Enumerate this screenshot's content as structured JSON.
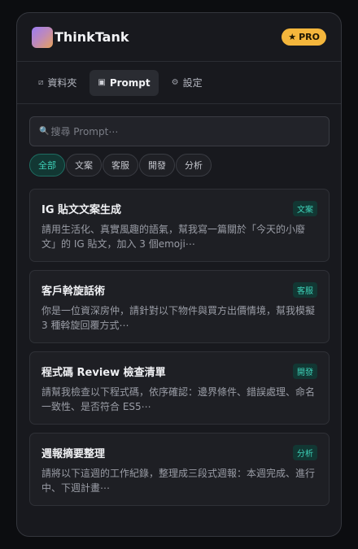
{
  "app": {
    "title": "ThinkTank",
    "badge": "PRO",
    "badge_icon": "★"
  },
  "colors": {
    "accent": "#3ed1b8",
    "badge_bg": "#f4b63c",
    "panel_bg": "#18191e"
  },
  "tabs": [
    {
      "label": "資料夾",
      "icon": "folder-icon",
      "glyph": "🗀",
      "active": false
    },
    {
      "label": "Prompt",
      "icon": "chat-icon",
      "glyph": "💬",
      "active": true
    },
    {
      "label": "設定",
      "icon": "gear-icon",
      "glyph": "⚙",
      "active": false
    }
  ],
  "search": {
    "placeholder": "搜尋 Prompt⋯",
    "icon": "search-icon"
  },
  "filters": [
    {
      "label": "全部",
      "active": true
    },
    {
      "label": "文案",
      "active": false
    },
    {
      "label": "客服",
      "active": false
    },
    {
      "label": "開發",
      "active": false
    },
    {
      "label": "分析",
      "active": false
    }
  ],
  "prompts": [
    {
      "title": "IG 貼文文案生成",
      "tag": "文案",
      "body": "請用生活化、真實風趣的語氣，幫我寫一篇關於「今天的小廢文」的 IG 貼文，加入 3 個emoji⋯"
    },
    {
      "title": "客戶斡旋話術",
      "tag": "客服",
      "body": "你是一位資深房仲，請針對以下物件與買方出價情境，幫我模擬 3 種斡旋回覆方式⋯"
    },
    {
      "title": "程式碼 Review 檢查清單",
      "tag": "開發",
      "body": "請幫我檢查以下程式碼，依序確認：邊界條件、錯誤處理、命名一致性、是否符合 ES5⋯"
    },
    {
      "title": "週報摘要整理",
      "tag": "分析",
      "body": "請將以下這週的工作紀錄，整理成三段式週報：本週完成、進行中、下週計畫⋯"
    }
  ]
}
